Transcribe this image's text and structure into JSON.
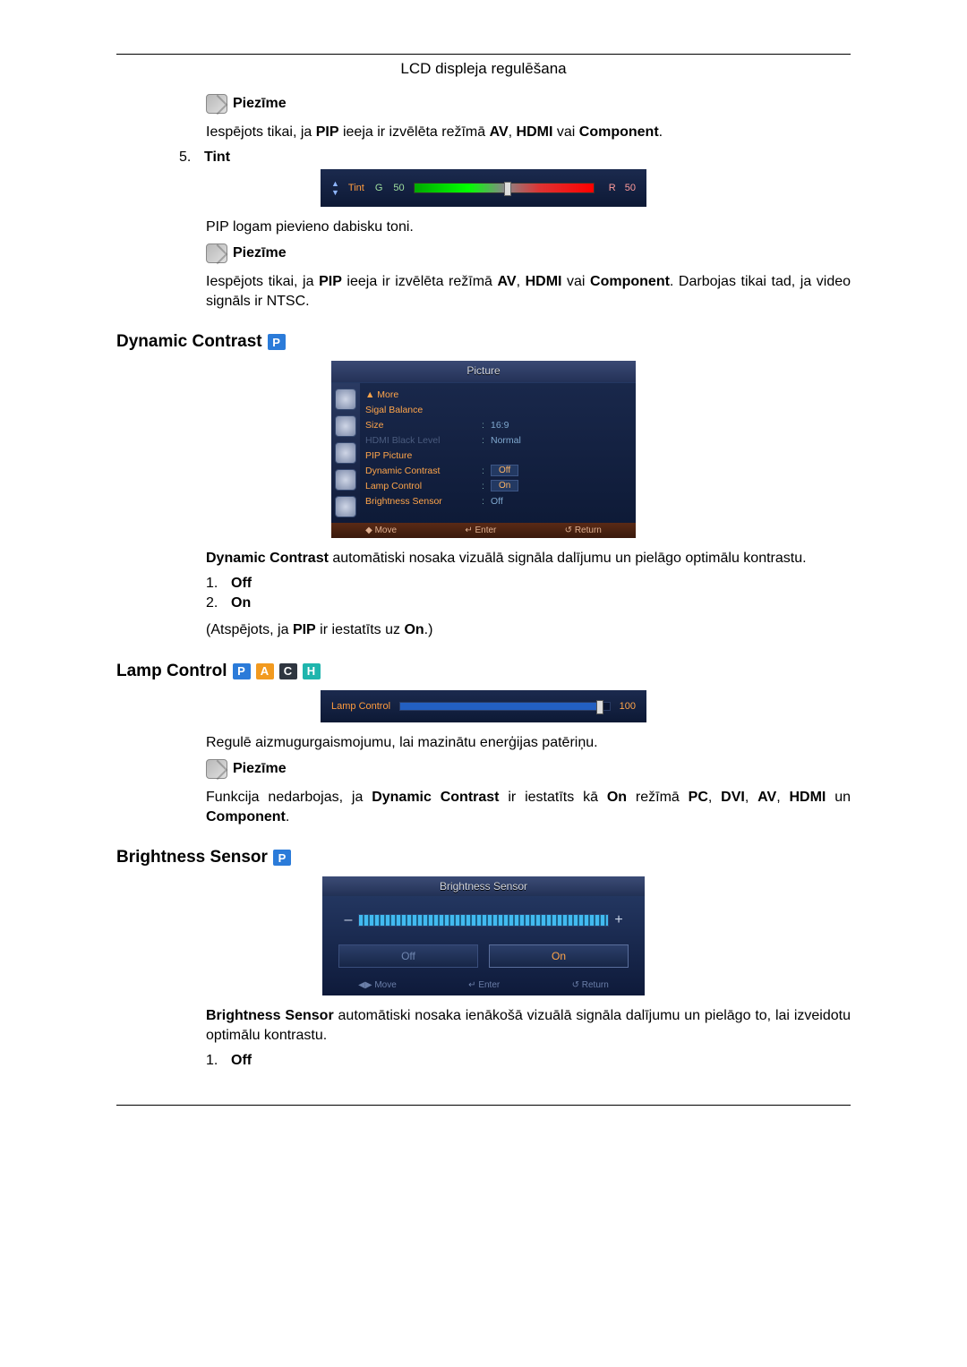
{
  "header": {
    "title": "LCD displeja regulēšana"
  },
  "note_label": "Piezīme",
  "section1": {
    "note_text": "Iespējots tikai, ja PIP ieeja ir izvēlēta režīmā AV, HDMI vai Component.",
    "item5_num": "5.",
    "item5_label": "Tint",
    "tint_osd": {
      "label": "Tint",
      "g_label": "G",
      "g_value": "50",
      "r_label": "R",
      "r_value": "50"
    },
    "body_after": "PIP logam pievieno dabisku toni.",
    "note2_text": "Iespējots tikai, ja PIP ieeja ir izvēlēta režīmā AV, HDMI vai Component. Darbojas tikai tad, ja video signāls ir NTSC."
  },
  "dynamic_contrast": {
    "heading": "Dynamic Contrast",
    "badge": "P",
    "osd": {
      "title": "Picture",
      "rows": {
        "more": "▲ More",
        "sigal_balance": "Sigal Balance",
        "size_l": "Size",
        "size_v": "16:9",
        "hdmi_l": "HDMI Black Level",
        "hdmi_v": "Normal",
        "pip_l": "PIP Picture",
        "dc_l": "Dynamic Contrast",
        "dc_v": "Off",
        "lamp_l": "Lamp Control",
        "lamp_v": "On",
        "bs_l": "Brightness Sensor",
        "bs_v": "Off"
      },
      "footer": {
        "move": "Move",
        "enter": "Enter",
        "return": "Return"
      }
    },
    "text": "Dynamic Contrast automātiski nosaka vizuālā signāla dalījumu un pielāgo optimālu kontrastu.",
    "list1_num": "1.",
    "list1_label": "Off",
    "list2_num": "2.",
    "list2_label": "On",
    "disabled_text": "(Atspējots, ja PIP ir iestatīts uz On.)"
  },
  "lamp_control": {
    "heading": "Lamp Control",
    "badges": [
      "P",
      "A",
      "C",
      "H"
    ],
    "osd": {
      "label": "Lamp Control",
      "value": "100"
    },
    "text": "Regulē aizmugurgaismojumu, lai mazinātu enerģijas patēriņu.",
    "note_text": "Funkcija nedarbojas, ja Dynamic Contrast ir iestatīts kā On režīmā PC, DVI, AV, HDMI un Component."
  },
  "brightness_sensor": {
    "heading": "Brightness Sensor",
    "badge": "P",
    "osd": {
      "title": "Brightness Sensor",
      "minus": "–",
      "plus": "+",
      "off": "Off",
      "on": "On",
      "footer": {
        "move": "Move",
        "enter": "Enter",
        "return": "Return"
      }
    },
    "text": "Brightness Sensor automātiski nosaka ienākošā vizuālā signāla dalījumu un pielāgo to, lai izveidotu optimālu kontrastu.",
    "list1_num": "1.",
    "list1_label": "Off"
  }
}
